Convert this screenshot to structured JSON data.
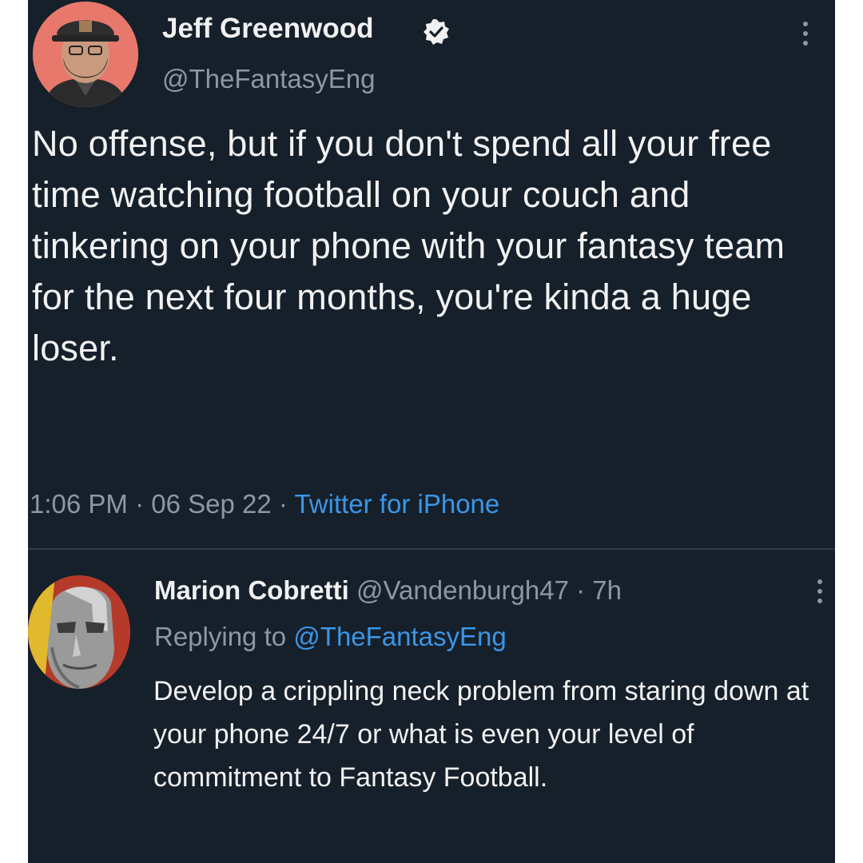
{
  "tweet": {
    "author_name": "Jeff Greenwood",
    "handle": "@TheFantasyEng",
    "text": "No offense, but if you don't spend all your free time watching football on your couch and tinkering on your phone with your fantasy team for the next four months, you're kinda a huge loser.",
    "time": "1:06 PM",
    "date": "06 Sep 22",
    "source": "Twitter for iPhone",
    "separator": "·",
    "verified_icon": "verified-badge-icon",
    "more_icon": "more-vertical-icon"
  },
  "reply": {
    "author_name": "Marion Cobretti",
    "handle": "@Vandenburgh47",
    "age": "7h",
    "separator": "·",
    "replying_label": "Replying to",
    "replying_handle": "@TheFantasyEng",
    "text": "Develop a crippling neck problem from staring down at your phone 24/7 or what is even your level of commitment to Fantasy Football.",
    "more_icon": "more-vertical-icon"
  },
  "colors": {
    "background": "#16202b",
    "text": "#f1f1f1",
    "secondary": "#8b98a5",
    "accent": "#3b96e6",
    "avatar1_bg": "#e8786c"
  }
}
